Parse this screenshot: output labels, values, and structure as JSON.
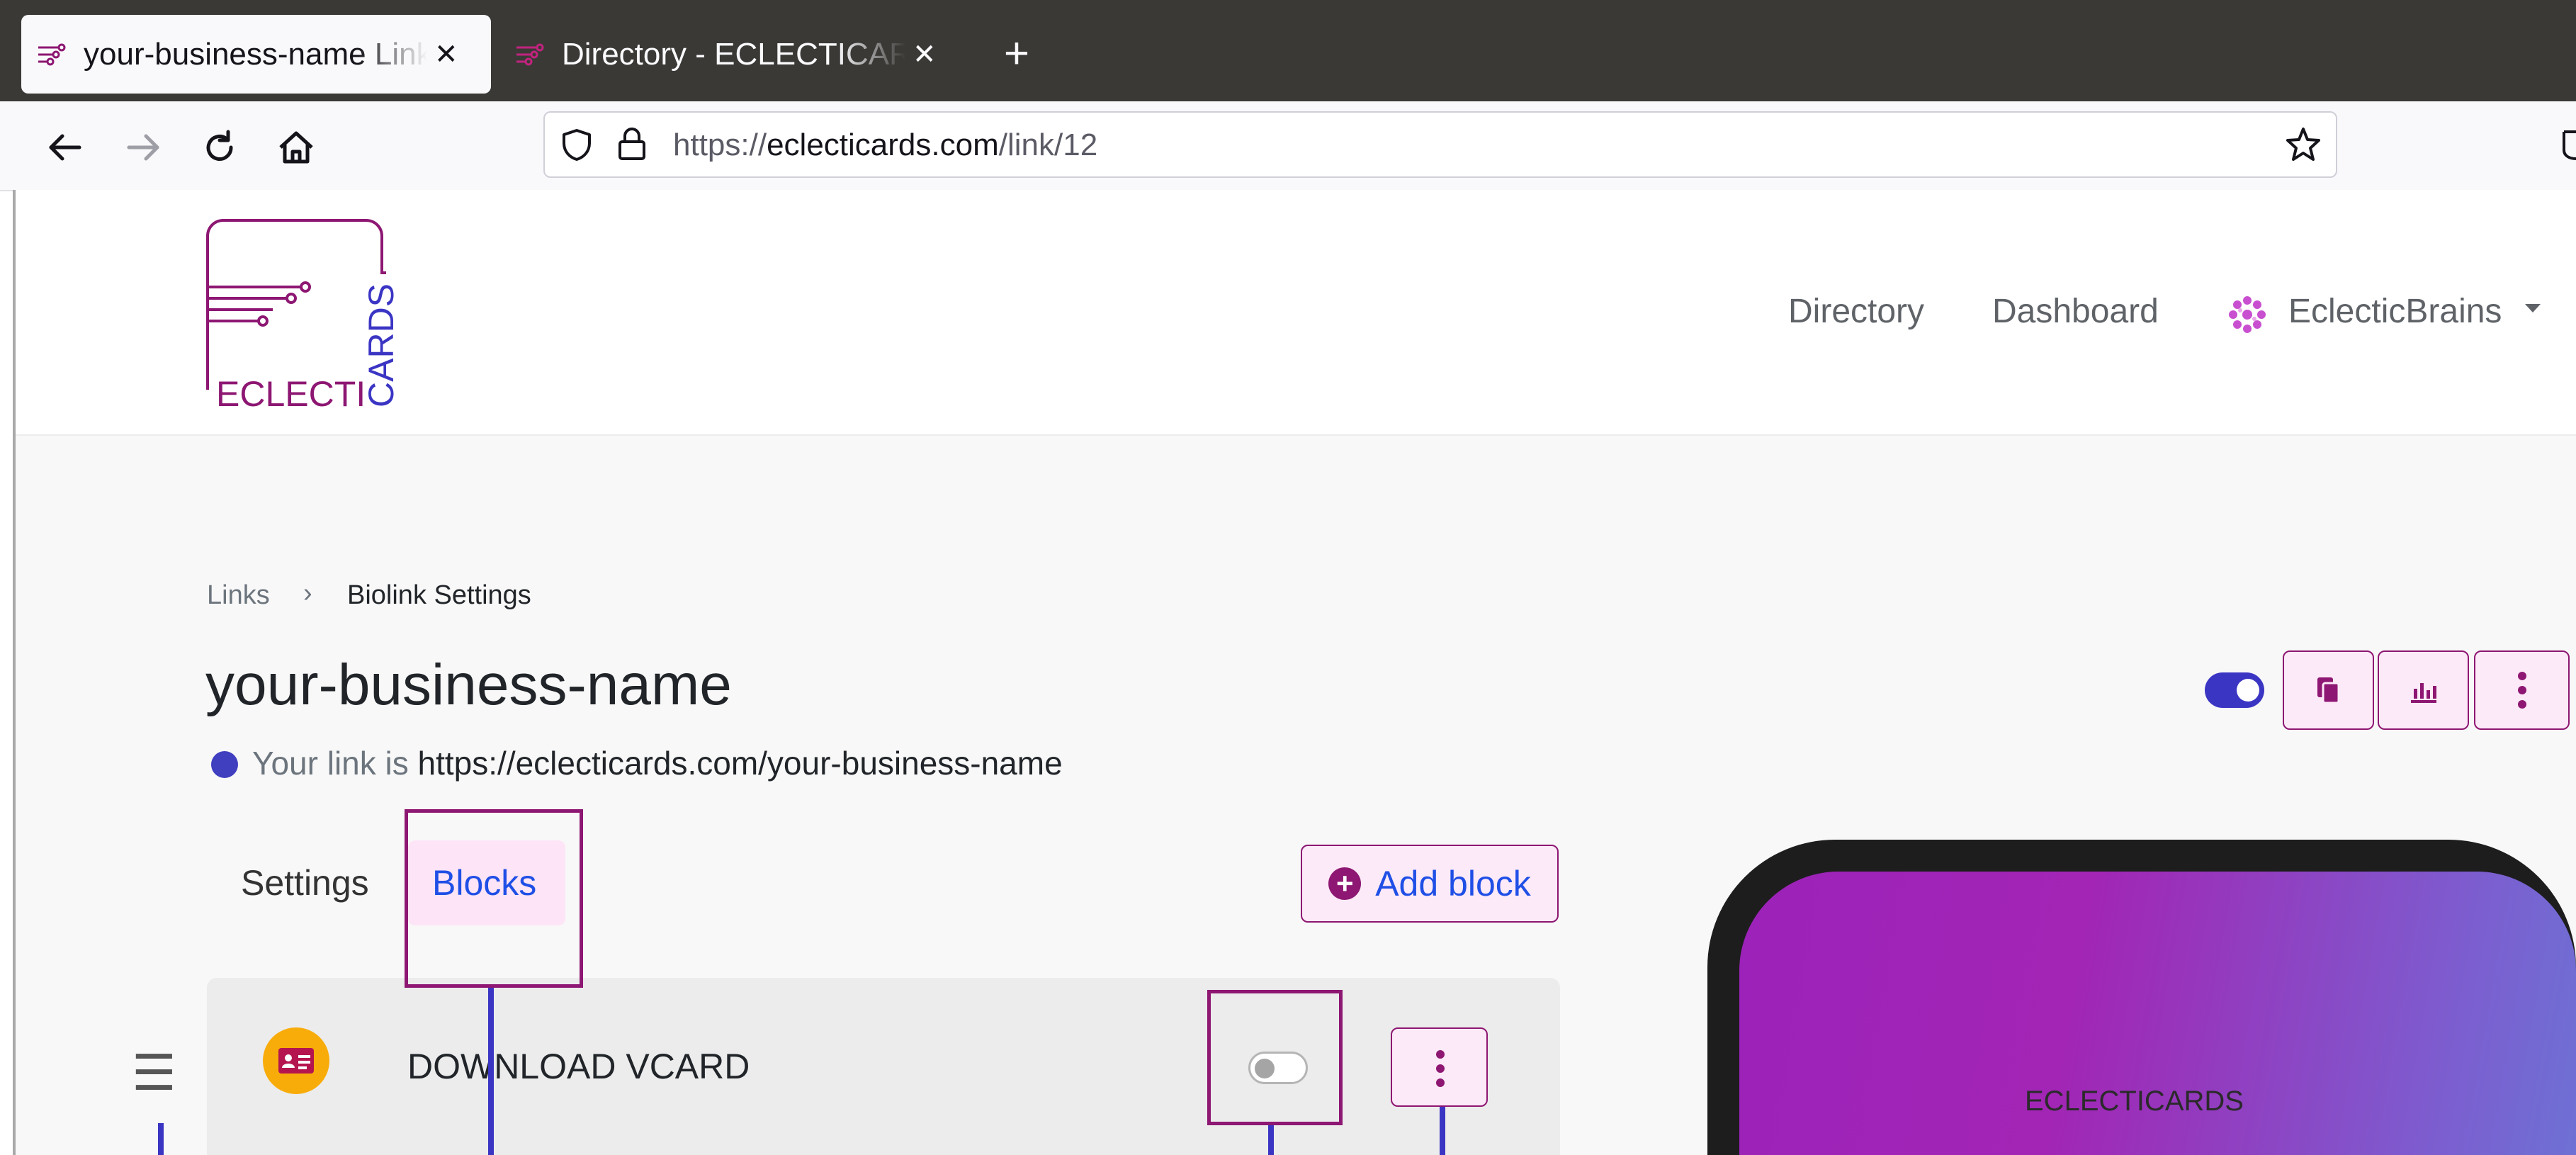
{
  "browser": {
    "tabs": [
      {
        "title": "your-business-name Link",
        "active": true
      },
      {
        "title": "Directory - ECLECTICARDS",
        "active": false
      }
    ],
    "new_tab_label": "+",
    "close_label": "✕",
    "url": {
      "scheme": "https://",
      "domain": "eclecticards.com",
      "path": "/link/12"
    }
  },
  "site": {
    "logo": {
      "text_left": "ECLECTI",
      "text_right": "CARDS",
      "colors": {
        "primary": "#8d1772",
        "secondary": "#3b35c4"
      }
    },
    "nav": {
      "directory": "Directory",
      "dashboard": "Dashboard",
      "account": "EclecticBrains"
    }
  },
  "breadcrumb": {
    "links": "Links",
    "separator": "›",
    "current": "Biolink Settings"
  },
  "page": {
    "title": "your-business-name",
    "link_prefix": "Your link is",
    "link_url": "https://eclecticards.com/your-business-name",
    "link_enabled": true
  },
  "tabs": {
    "settings": "Settings",
    "blocks": "Blocks",
    "active": "blocks"
  },
  "actions": {
    "add_block": "Add block"
  },
  "blocks": [
    {
      "name": "DOWNLOAD VCARD",
      "icon": "vcard-icon",
      "enabled": false
    }
  ],
  "preview": {
    "brand": "ECLECTICARDS"
  },
  "colors": {
    "accent": "#8d1772",
    "link_blue": "#1f4fe6",
    "toggle_on": "#3b35c4",
    "vcard_icon_bg": "#f8ac0a",
    "annotation_box": "#8d1772",
    "annotation_line": "#3b35c4"
  }
}
